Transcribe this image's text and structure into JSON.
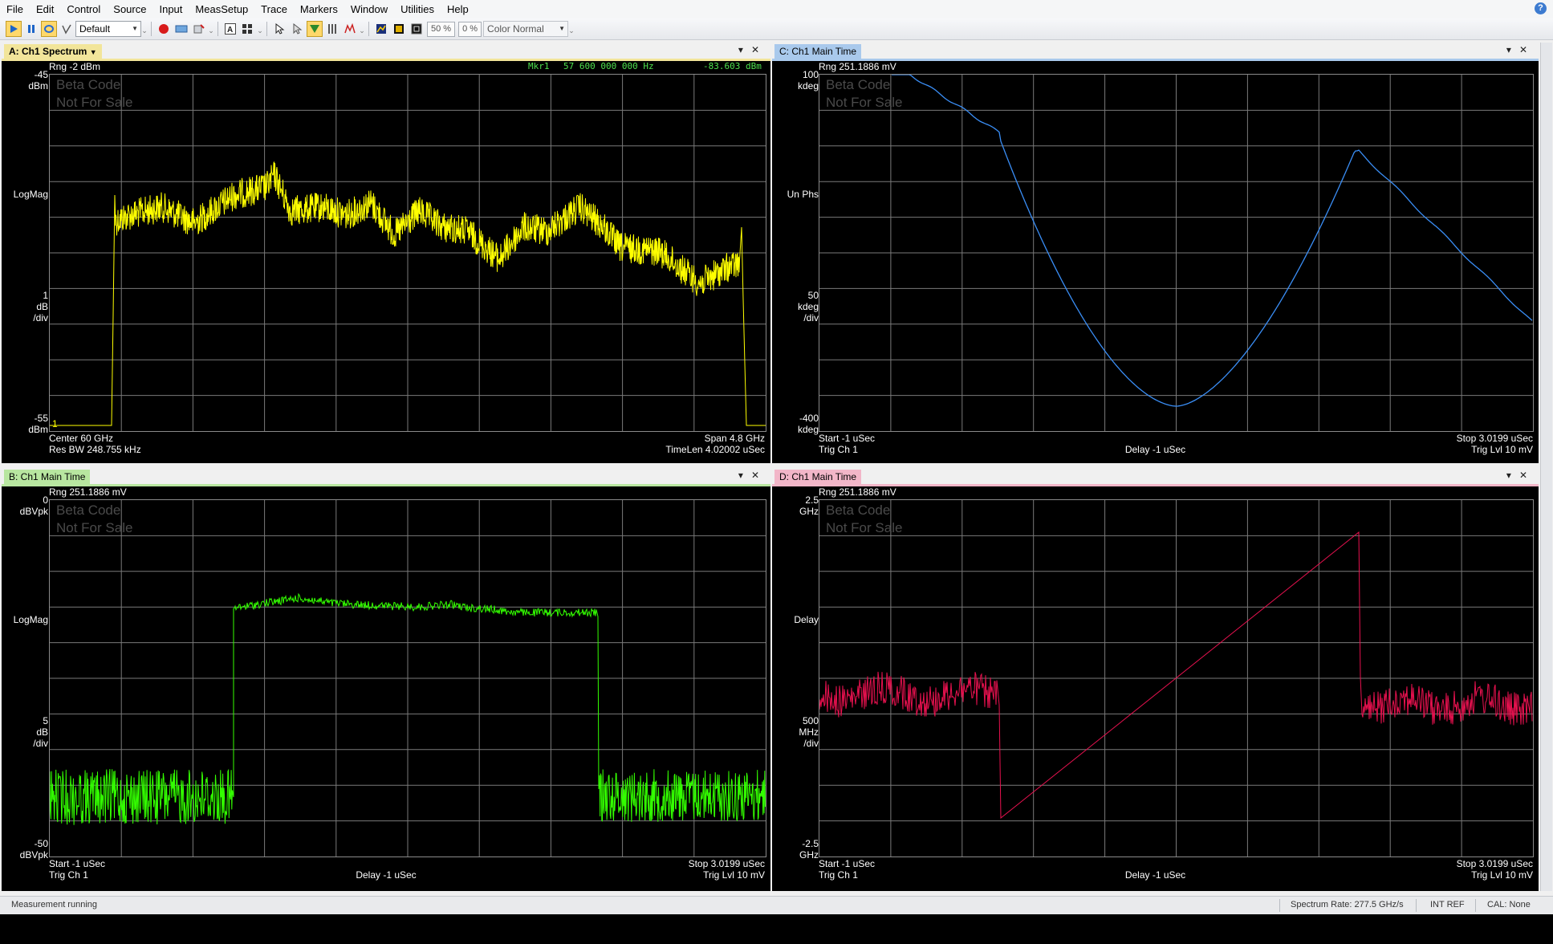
{
  "menu": [
    "File",
    "Edit",
    "Control",
    "Source",
    "Input",
    "MeasSetup",
    "Trace",
    "Markers",
    "Window",
    "Utilities",
    "Help"
  ],
  "toolbar": {
    "preset": "Default",
    "zoom1": "50 %",
    "zoom2": "0 %",
    "color_mode": "Color Normal",
    "icons": [
      "play-icon",
      "pause-icon",
      "loop-icon",
      "path-icon",
      "record-icon",
      "preset-icon",
      "marker-icon",
      "text-icon",
      "layout-icon",
      "pointer-icon",
      "select-icon",
      "columns-icon",
      "trigger-icon",
      "peak-icon",
      "scale-icon",
      "palette-icon",
      "persist-icon",
      "grid-icon"
    ]
  },
  "watermark": {
    "line1": "Beta Code",
    "line2": "Not For Sale"
  },
  "panes": {
    "A": {
      "tab": "A: Ch1 Spectrum",
      "accent": "#f2e59a",
      "rng": "Rng -2 dBm",
      "marker_name": "Mkr1",
      "marker_freq": "57 600 000 000 Hz",
      "marker_val": "-83.603 dBm",
      "y_top_val": "-45",
      "y_top_unit": "dBm",
      "y_format": "LogMag",
      "y_scale_val": "1",
      "y_scale_unit": "dB",
      "y_scale_div": "/div",
      "y_bot_val": "-55",
      "y_bot_unit": "dBm",
      "marker_label": "1",
      "bl1": "Center 60 GHz",
      "bl2": "Res BW 248.755 kHz",
      "br1": "Span 4.8 GHz",
      "br2": "TimeLen 4.02002 uSec",
      "trace_color": "#ffff00"
    },
    "B": {
      "tab": "B: Ch1 Main Time",
      "accent": "#b8e6a0",
      "rng": "Rng 251.1886 mV",
      "y_top_val": "0",
      "y_top_unit": "dBVpk",
      "y_format": "LogMag",
      "y_scale_val": "5",
      "y_scale_unit": "dB",
      "y_scale_div": "/div",
      "y_bot_val": "-50",
      "y_bot_unit": "dBVpk",
      "bl1": "Start -1 uSec",
      "bl2": "Trig Ch 1",
      "bc": "Delay -1 uSec",
      "br1": "Stop 3.0199 uSec",
      "br2": "Trig Lvl 10 mV",
      "trace_color": "#33ff00"
    },
    "C": {
      "tab": "C: Ch1 Main Time",
      "accent": "#a9c9ec",
      "rng": "Rng 251.1886 mV",
      "y_top_val": "100",
      "y_top_unit": "kdeg",
      "y_format": "Un Phs",
      "y_scale_val": "50",
      "y_scale_unit": "kdeg",
      "y_scale_div": "/div",
      "y_bot_val": "-400",
      "y_bot_unit": "kdeg",
      "bl1": "Start -1 uSec",
      "bl2": "Trig Ch 1",
      "bc": "Delay -1 uSec",
      "br1": "Stop 3.0199 uSec",
      "br2": "Trig Lvl 10 mV",
      "trace_color": "#3a8ef6"
    },
    "D": {
      "tab": "D: Ch1 Main Time",
      "accent": "#f2b6c8",
      "rng": "Rng 251.1886 mV",
      "y_top_val": "2.5",
      "y_top_unit": "GHz",
      "y_format": "Delay",
      "y_scale_val": "500",
      "y_scale_unit": "MHz",
      "y_scale_div": "/div",
      "y_bot_val": "-2.5",
      "y_bot_unit": "GHz",
      "bl1": "Start -1 uSec",
      "bl2": "Trig Ch 1",
      "bc": "Delay -1 uSec",
      "br1": "Stop 3.0199 uSec",
      "br2": "Trig Lvl 10 mV",
      "trace_color": "#e8114f"
    }
  },
  "status": {
    "left": "Measurement running",
    "rate": "Spectrum Rate: 277.5 GHz/s",
    "ref": "INT REF",
    "cal": "CAL: None"
  }
}
